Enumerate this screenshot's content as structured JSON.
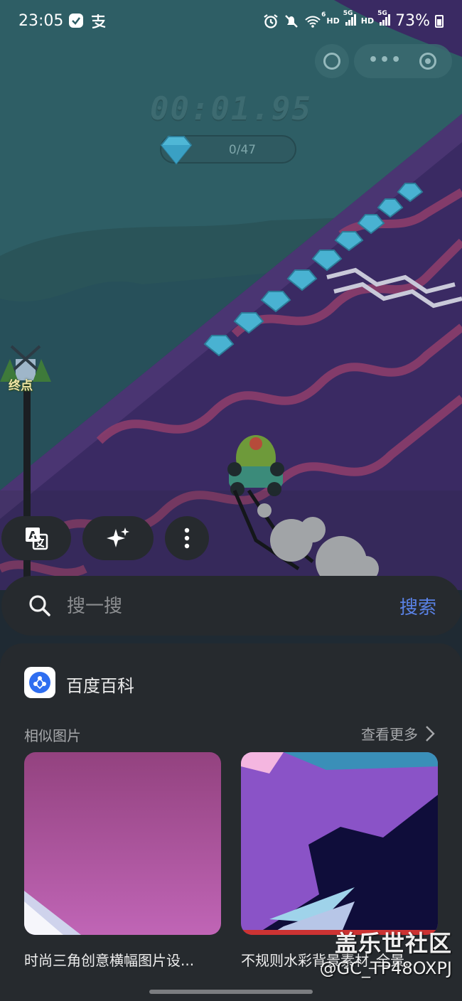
{
  "status_bar": {
    "time": "23:05",
    "left_icons": [
      "check-badge-icon",
      "alipay-icon"
    ],
    "right_icons": [
      "alarm-icon",
      "mute-icon",
      "wifi-icon",
      "hd-icon",
      "signal-5g-icon",
      "hd-icon",
      "signal-5g-icon"
    ],
    "battery": "73%",
    "hd_label": "HD",
    "net_label": "5G",
    "wifi_sub": "6"
  },
  "game": {
    "timer": "00:01.95",
    "gem_count": "0/47",
    "finish_label": "终点",
    "accent_colors": {
      "sky": "#2f6066",
      "track": "#3c2a63",
      "stripe": "#8a3a6a",
      "gem": "#4fb7d6"
    }
  },
  "quick_actions": [
    {
      "name": "translate-icon"
    },
    {
      "name": "sparkle-icon"
    },
    {
      "name": "more-vertical-icon"
    }
  ],
  "search": {
    "placeholder": "搜一搜",
    "button_label": "搜索"
  },
  "result": {
    "source_title": "百度百科",
    "section_label": "相似图片",
    "see_more": "查看更多",
    "images": [
      {
        "title": "时尚三角创意横幅图片设...",
        "colors": [
          "#9e4a93",
          "#c063b4"
        ]
      },
      {
        "title": "不规则水彩背景素材_全景...",
        "colors": [
          "#8a53c7",
          "#0f0d3a"
        ]
      }
    ]
  },
  "watermark": {
    "line1": "盖乐世社区",
    "line2": "@GC_TP48OXPJ"
  }
}
